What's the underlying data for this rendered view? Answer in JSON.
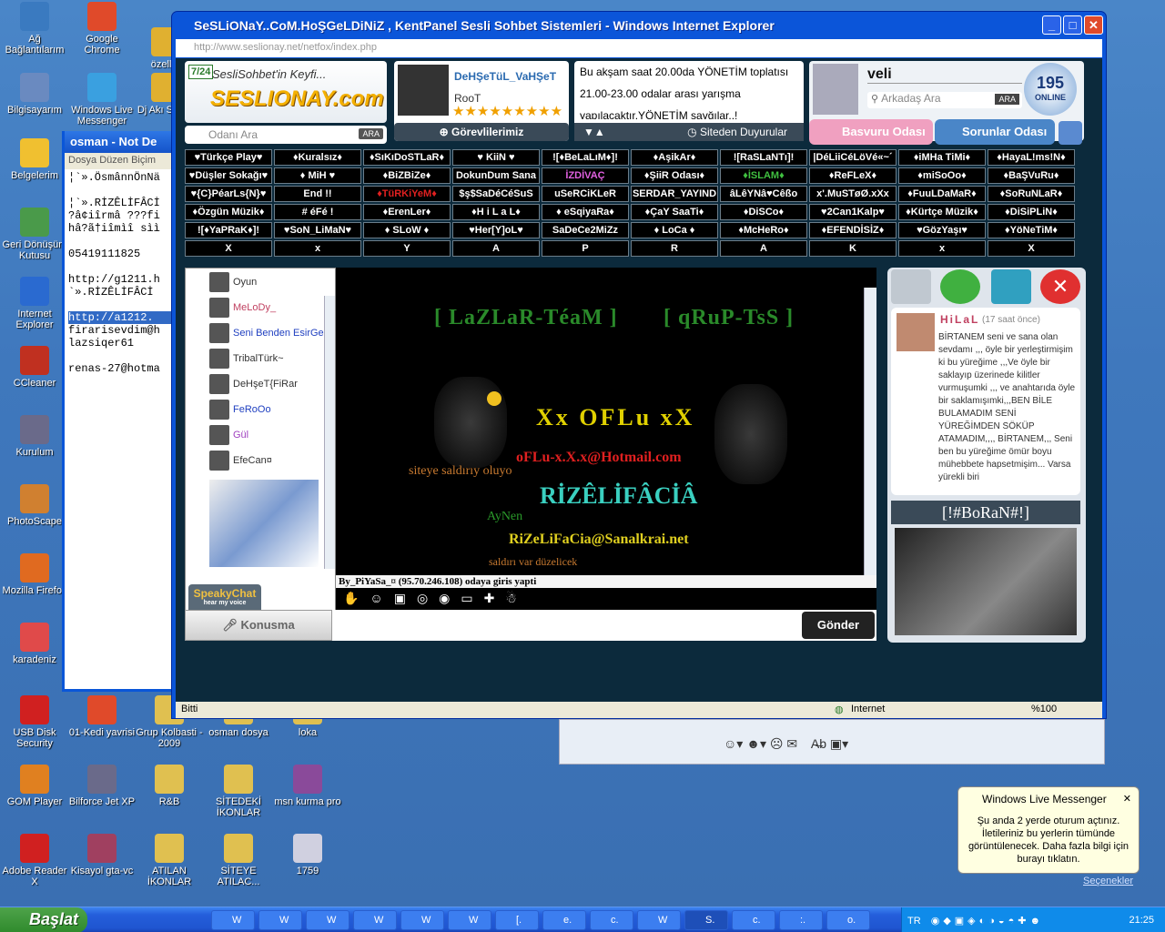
{
  "desktop": {
    "icons": [
      {
        "label": "Ağ Bağlantılarım"
      },
      {
        "label": "Google Chrome"
      },
      {
        "label": "özeller"
      },
      {
        "label": "Bilgisayarım"
      },
      {
        "label": "Windows Live Messenger"
      },
      {
        "label": "Dj Akı Son N"
      },
      {
        "label": "Belgelerim"
      },
      {
        "label": "Geri Dönüşüm Kutusu"
      },
      {
        "label": "Internet Explorer"
      },
      {
        "label": "CCleaner"
      },
      {
        "label": "Kurulum"
      },
      {
        "label": "PhotoScape"
      },
      {
        "label": "Mozilla Firefox"
      },
      {
        "label": "karadeniz"
      },
      {
        "label": "USB Disk Security"
      },
      {
        "label": "01-Kedi yavrisi"
      },
      {
        "label": "Grup Kolbasti - 2009"
      },
      {
        "label": "osman dosya"
      },
      {
        "label": "loka"
      },
      {
        "label": "GOM Player"
      },
      {
        "label": "Bilforce Jet XP"
      },
      {
        "label": "R&B"
      },
      {
        "label": "SİTEDEKİ İKONLAR"
      },
      {
        "label": "msn kurma pro"
      },
      {
        "label": "Adobe Reader X"
      },
      {
        "label": "Kisayol gta-vc"
      },
      {
        "label": "ATILAN İKONLAR"
      },
      {
        "label": "SİTEYE ATILAC..."
      },
      {
        "label": "1759"
      }
    ]
  },
  "notepad": {
    "title": "osman - Not De",
    "menu": "Dosya  Düzen  Biçim",
    "lines": [
      "¦`».ÖsmânnÖnNä",
      "",
      "¦`».RİZÊLİFÂCİ",
      "?â¢iîrmâ ???fi",
      "hâ?ã†iîmìî sìì",
      "",
      "05419111825",
      "",
      "http://g1211.h",
      "`».RİZÊLİFÂCİ",
      "",
      "http://a1212.",
      "firarisevdim@h",
      "lazsiqer61",
      "",
      "renas-27@hotma"
    ]
  },
  "ie": {
    "title": "SeSLiONaY..CoM.HoŞGeLDiNiZ , KentPanel Sesli Sohbet Sistemleri - Windows Internet Explorer",
    "address": "http://www.seslionay.net/netfox/index.php",
    "status_left": "Bitti",
    "status_zone": "Internet",
    "zoom": "%100"
  },
  "site": {
    "logo_tag": "SesliSohbet'in Keyfi...",
    "logo_name": "SESLIONAY.com",
    "logo_badge": "7/24",
    "search_placeholder": "Odanı Ara",
    "search_btn": "ARA",
    "featured_user": "DeHŞeTüL_VaHŞeT",
    "featured_role": "RooT",
    "staff_btn": "Görevlilerimiz",
    "announcement": "Bu akşam saat 20.00da YÖNETİM toplatısı 21.00-23.00 odalar arası yarışma yapılacaktır.YÖNETİM sayğılar..!",
    "ann_btn": "Siteden Duyurular",
    "me_name": "veli",
    "me_search": "Arkadaş Ara",
    "me_search_btn": "ARA",
    "online_count": "195",
    "online_label": "ONLINE",
    "basvuru": "Basvuru Odası",
    "sorunlar": "Sorunlar Odası",
    "rooms": [
      [
        "♥Türkçe Play♥",
        "♦Kuralsız♦",
        "♦SıKıDoSTLaR♦",
        "♥ KiiN ♥",
        "![♦BeLaLıM♦]!",
        "♦AşikAr♦",
        "![RaSLaNTı]!",
        "|DéLiiCéLöVé«~´",
        "♦iMHa TiMi♦",
        "♦HayaL!ms!N♦"
      ],
      [
        "♥Düşler Sokağı♥",
        "♦ MiH ♥",
        "♦BiZBiZe♦",
        "DokunDum Sana",
        "İZDİVAÇ",
        "♦ŞiiR Odası♦",
        "♦İSLAM♦",
        "♦ReFLeX♦",
        "♦miSoOo♦",
        "♦BaŞVuRu♦"
      ],
      [
        "♥{C}PéarLs{N}♥",
        "End !!",
        "♦TüRKiYeM♦",
        "$ş$SaDéCéSuS",
        "uSeRCiKLeR",
        "SERDAR_YAYIND",
        "âLêYNâ♥Cêßo",
        "x'.MuSTøØ.xXx",
        "♦FuuLDaMaR♦",
        "♦SoRuNLaR♦"
      ],
      [
        "♦Özgün Müzik♦",
        "# éFé !",
        "♦ErenLer♦",
        "♦H i L a L♦",
        "♦ eSqiyaRa♦",
        "♦ÇaY SaaTi♦",
        "♦DiSCo♦",
        "♥2Can1Kalp♥",
        "♦Kürtçe Müzik♦",
        "♦DiSiPLiN♦"
      ],
      [
        "![♦YaPRaK♦]!",
        "♥SoN_LiMaN♥",
        "♦ SLoW ♦",
        "♥Her[Y]oL♥",
        "SaDeCe2MiZz",
        "♦ LoCa ♦",
        "♦McHeRo♦",
        "♦EFENDİSİZ♦",
        "♥GözYaşı♥",
        "♦YöNeTiM♦"
      ],
      [
        "X",
        "x",
        "Y",
        "A",
        "P",
        "R",
        "A",
        "K",
        "x",
        "X"
      ]
    ],
    "users": [
      {
        "name": "Oyun",
        "color": "#333"
      },
      {
        "name": "MeLoDy_",
        "color": "#c04060"
      },
      {
        "name": "Seni Benden EsirGer",
        "color": "#2040c0"
      },
      {
        "name": "TribalTürk~",
        "color": "#333"
      },
      {
        "name": "DeHşeT{FiRar",
        "color": "#333"
      },
      {
        "name": "FeRoOo",
        "color": "#2040c0"
      },
      {
        "name": "Gül",
        "color": "#a040c0"
      },
      {
        "name": "EfeCan¤",
        "color": "#333"
      }
    ],
    "speak_logo": "SpeakyChat",
    "speak_sub": "hear my voice",
    "konusma": "Konusma",
    "chat": {
      "banner_left": "[ LaZLaR-TéaM ]",
      "banner_right": "[ qRuP-TsS ]",
      "center_name": "Xx OFLu xX",
      "center_mail": "oFLu-x.X.x@Hotmail.com",
      "warn": "siteye saldırıy oluyo",
      "aynen": "AyNen",
      "rize": "RİZÊLİFÂCİÂ",
      "rize_mail": "RiZeLiFaCia@Sanalkrai.net",
      "saldiri": "saldırı var düzelicek",
      "system_line": "By_PiYaSa_¤ (95.70.246.108) odaya giris yapti"
    },
    "send_btn": "Gönder",
    "msg_user": "HiLaL",
    "msg_time": "(17 saat önce)",
    "msg_text": "BİRTANEM seni ve sana olan sevdamı ,,, öyle bir yerleştirmişim ki bu yüreğime ,,,Ve öyle bir saklayıp üzerinede kilitler vurmuşumki ,,, ve anahtarıda öyle bir saklamışımki,,,BEN BİLE BULAMADIM SENİ YÜREĞİMDEN SÖKÜP ATAMADIM,,,, BİRTANEM,,, Seni ben bu yüreğime ömür boyu mühebbete hapsetmişim... Varsa yürekli biri",
    "profile_name": "[!#BoRaN#!]"
  },
  "balloon": {
    "title": "Windows Live Messenger",
    "text": "Şu anda 2 yerde oturum açtınız. İletileriniz bu yerlerin tümünde görüntülenecek. Daha fazla bilgi için burayı tıklatın.",
    "link": "Seçenekler"
  },
  "taskbar": {
    "start": "Başlat",
    "buttons": [
      "W",
      "W",
      "W",
      "W",
      "W",
      "W",
      "[.",
      "e.",
      "c.",
      "W",
      "S.",
      "c.",
      ":.",
      "o."
    ],
    "lang": "TR",
    "clock": "21:25"
  },
  "colors": {
    "accent": "#0b55d9",
    "site_bg": "#0c2a3c",
    "room_bg": "#000000"
  }
}
